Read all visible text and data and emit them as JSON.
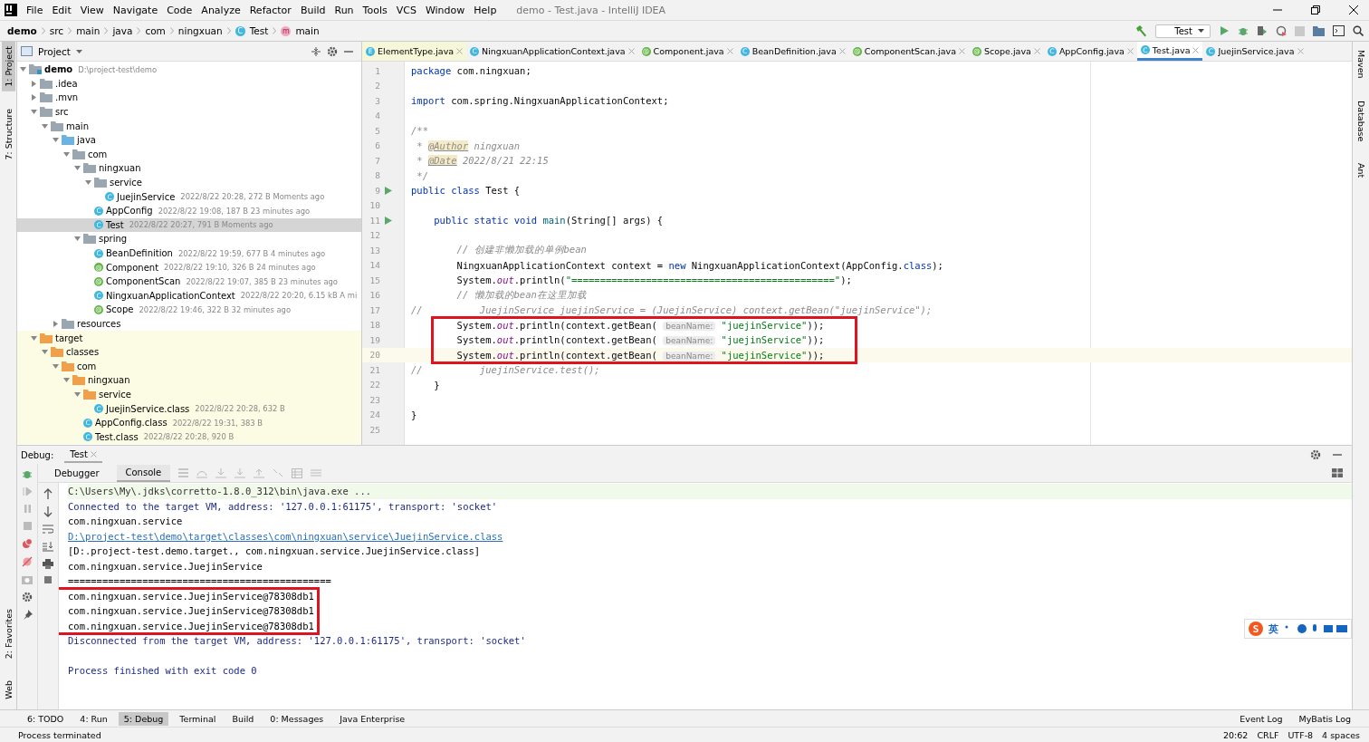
{
  "window": {
    "title": "demo - Test.java - IntelliJ IDEA"
  },
  "menu": [
    "File",
    "Edit",
    "View",
    "Navigate",
    "Code",
    "Analyze",
    "Refactor",
    "Build",
    "Run",
    "Tools",
    "VCS",
    "Window",
    "Help"
  ],
  "breadcrumbs": [
    {
      "label": "demo",
      "kind": "project"
    },
    {
      "label": "src",
      "kind": "dir"
    },
    {
      "label": "main",
      "kind": "dir"
    },
    {
      "label": "java",
      "kind": "dir"
    },
    {
      "label": "com",
      "kind": "dir"
    },
    {
      "label": "ningxuan",
      "kind": "dir"
    },
    {
      "label": "Test",
      "kind": "class",
      "icon": "C"
    },
    {
      "label": "main",
      "kind": "method",
      "icon": "m"
    }
  ],
  "run_config": "Test",
  "left_stripe": [
    {
      "label": "1: Project",
      "selected": true
    },
    {
      "label": "7: Structure",
      "selected": false
    }
  ],
  "left_stripe_bottom": [
    {
      "label": "2: Favorites",
      "selected": false
    },
    {
      "label": "Web",
      "selected": false
    }
  ],
  "right_stripe": [
    {
      "label": "Maven"
    },
    {
      "label": "Database"
    },
    {
      "label": "Ant"
    }
  ],
  "project_panel": {
    "title": "Project",
    "tree": [
      {
        "label": "demo",
        "kind": "module",
        "meta": "D:\\project-test\\demo",
        "expanded": true,
        "children": [
          {
            "label": ".idea",
            "kind": "folder",
            "expanded": false
          },
          {
            "label": ".mvn",
            "kind": "folder",
            "expanded": false
          },
          {
            "label": "src",
            "kind": "folder",
            "expanded": true,
            "children": [
              {
                "label": "main",
                "kind": "folder",
                "expanded": true,
                "children": [
                  {
                    "label": "java",
                    "kind": "source-root",
                    "expanded": true,
                    "children": [
                      {
                        "label": "com",
                        "kind": "package",
                        "expanded": true,
                        "children": [
                          {
                            "label": "ningxuan",
                            "kind": "package",
                            "expanded": true,
                            "children": [
                              {
                                "label": "service",
                                "kind": "package",
                                "expanded": true,
                                "children": [
                                  {
                                    "label": "JuejinService",
                                    "kind": "class",
                                    "icon": "C",
                                    "meta": "2022/8/22 20:28, 272 B Moments ago",
                                    "selected": false
                                  }
                                ]
                              },
                              {
                                "label": "AppConfig",
                                "kind": "class",
                                "icon": "C",
                                "meta": "2022/8/22 19:08, 187 B 23 minutes ago",
                                "selected": false
                              },
                              {
                                "label": "Test",
                                "kind": "runnable-class",
                                "icon": "C",
                                "meta": "2022/8/22 20:27, 791 B Moments ago",
                                "selected": true
                              }
                            ]
                          },
                          {
                            "label": "spring",
                            "kind": "package",
                            "expanded": true,
                            "children": [
                              {
                                "label": "BeanDefinition",
                                "kind": "class",
                                "icon": "C",
                                "meta": "2022/8/22 19:59, 677 B 4 minutes ago",
                                "selected": false
                              },
                              {
                                "label": "Component",
                                "kind": "annotation",
                                "icon": "@",
                                "meta": "2022/8/22 19:10, 326 B 24 minutes ago",
                                "selected": false
                              },
                              {
                                "label": "ComponentScan",
                                "kind": "annotation",
                                "icon": "@",
                                "meta": "2022/8/22 19:07, 385 B 23 minutes ago",
                                "selected": false
                              },
                              {
                                "label": "NingxuanApplicationContext",
                                "kind": "class",
                                "icon": "C",
                                "meta": "2022/8/22 20:20, 6.15 kB A mi",
                                "selected": false
                              },
                              {
                                "label": "Scope",
                                "kind": "annotation",
                                "icon": "@",
                                "meta": "2022/8/22 19:46, 322 B 32 minutes ago",
                                "selected": false
                              }
                            ]
                          }
                        ]
                      }
                    ]
                  },
                  {
                    "label": "resources",
                    "kind": "resources",
                    "expanded": false
                  }
                ]
              }
            ]
          },
          {
            "label": "target",
            "kind": "excluded-folder",
            "expanded": true,
            "children": [
              {
                "label": "classes",
                "kind": "excluded-folder",
                "expanded": true,
                "children": [
                  {
                    "label": "com",
                    "kind": "excluded-folder",
                    "expanded": true,
                    "children": [
                      {
                        "label": "ningxuan",
                        "kind": "excluded-folder",
                        "expanded": true,
                        "children": [
                          {
                            "label": "service",
                            "kind": "excluded-folder",
                            "expanded": true,
                            "children": [
                              {
                                "label": "JuejinService.class",
                                "kind": "class",
                                "icon": "C",
                                "meta": "2022/8/22 20:28, 632 B",
                                "selected": false
                              }
                            ]
                          },
                          {
                            "label": "AppConfig.class",
                            "kind": "class",
                            "icon": "C",
                            "meta": "2022/8/22 19:31, 383 B",
                            "selected": false
                          },
                          {
                            "label": "Test.class",
                            "kind": "runnable-class",
                            "icon": "C",
                            "meta": "2022/8/22 20:28, 920 B",
                            "selected": false
                          }
                        ]
                      }
                    ]
                  }
                ]
              }
            ]
          }
        ]
      }
    ]
  },
  "editor": {
    "tabs": [
      {
        "label": "ElementType.java",
        "kind": "enum",
        "icon": "E",
        "selected": false
      },
      {
        "label": "NingxuanApplicationContext.java",
        "kind": "class",
        "icon": "C",
        "selected": false
      },
      {
        "label": "Component.java",
        "kind": "annotation",
        "icon": "@",
        "selected": false
      },
      {
        "label": "BeanDefinition.java",
        "kind": "class",
        "icon": "C",
        "selected": false
      },
      {
        "label": "ComponentScan.java",
        "kind": "annotation",
        "icon": "@",
        "selected": false
      },
      {
        "label": "Scope.java",
        "kind": "annotation",
        "icon": "@",
        "selected": false
      },
      {
        "label": "AppConfig.java",
        "kind": "class",
        "icon": "C",
        "selected": false
      },
      {
        "label": "Test.java",
        "kind": "runnable-class",
        "icon": "C",
        "selected": true
      },
      {
        "label": "JuejinService.java",
        "kind": "class",
        "icon": "C",
        "selected": false
      }
    ],
    "lines": [
      {
        "num": "1",
        "run": false,
        "current": false,
        "segs": [
          {
            "kind": "keyword",
            "text": "package"
          },
          {
            "kind": "plain",
            "text": " com.ningxuan;"
          }
        ]
      },
      {
        "num": "2",
        "run": false,
        "current": false
      },
      {
        "num": "3",
        "run": false,
        "current": false,
        "segs": [
          {
            "kind": "keyword",
            "text": "import"
          },
          {
            "kind": "plain",
            "text": " com.spring.NingxuanApplicationContext;"
          }
        ]
      },
      {
        "num": "4",
        "run": false,
        "current": false
      },
      {
        "num": "5",
        "run": false,
        "current": false,
        "segs": [
          {
            "kind": "comment",
            "text": "/**"
          }
        ]
      },
      {
        "num": "6",
        "run": false,
        "current": false,
        "segs": [
          {
            "kind": "comment",
            "text": " * "
          },
          {
            "kind": "doctag",
            "text": "@Author"
          },
          {
            "kind": "comment",
            "text": " ningxuan"
          }
        ]
      },
      {
        "num": "7",
        "run": false,
        "current": false,
        "segs": [
          {
            "kind": "comment",
            "text": " * "
          },
          {
            "kind": "doctag",
            "text": "@Date"
          },
          {
            "kind": "comment",
            "text": " 2022/8/21 22:15"
          }
        ]
      },
      {
        "num": "8",
        "run": false,
        "current": false,
        "segs": [
          {
            "kind": "comment",
            "text": " */"
          }
        ]
      },
      {
        "num": "9",
        "run": true,
        "current": false,
        "segs": [
          {
            "kind": "keyword",
            "text": "public class"
          },
          {
            "kind": "plain",
            "text": " Test {"
          }
        ]
      },
      {
        "num": "10",
        "run": false,
        "current": false
      },
      {
        "num": "11",
        "run": true,
        "current": false,
        "segs": [
          {
            "kind": "keyword",
            "text": "    public static void"
          },
          {
            "kind": "method",
            "text": " main"
          },
          {
            "kind": "plain",
            "text": "(String[] args) {"
          }
        ]
      },
      {
        "num": "12",
        "run": false,
        "current": false
      },
      {
        "num": "13",
        "run": false,
        "current": false,
        "segs": [
          {
            "kind": "comment",
            "text": "        // 创建非懒加载的单例bean"
          }
        ]
      },
      {
        "num": "14",
        "run": false,
        "current": false,
        "segs": [
          {
            "kind": "plain",
            "text": "        NingxuanApplicationContext context = "
          },
          {
            "kind": "keyword",
            "text": "new"
          },
          {
            "kind": "plain",
            "text": " NingxuanApplicationContext(AppConfig."
          },
          {
            "kind": "keyword",
            "text": "class"
          },
          {
            "kind": "plain",
            "text": ");"
          }
        ]
      },
      {
        "num": "15",
        "run": false,
        "current": false,
        "segs": [
          {
            "kind": "plain",
            "text": "        System."
          },
          {
            "kind": "field",
            "text": "out"
          },
          {
            "kind": "plain",
            "text": ".println("
          },
          {
            "kind": "string",
            "text": "\"==============================================\""
          },
          {
            "kind": "plain",
            "text": ");"
          }
        ]
      },
      {
        "num": "16",
        "run": false,
        "current": false,
        "segs": [
          {
            "kind": "comment",
            "text": "        // 懒加载的bean在这里加载"
          }
        ]
      },
      {
        "num": "17",
        "run": false,
        "current": false,
        "segs": [
          {
            "kind": "comment",
            "text": "//          JuejinService juejinService = (JuejinService) context.getBean(\"juejinService\");"
          }
        ]
      },
      {
        "num": "18",
        "run": false,
        "current": false,
        "boxed": true,
        "segs": [
          {
            "kind": "plain",
            "text": "        System."
          },
          {
            "kind": "field",
            "text": "out"
          },
          {
            "kind": "plain",
            "text": ".println(context.getBean( "
          },
          {
            "kind": "hint",
            "text": "beanName:"
          },
          {
            "kind": "string",
            "text": " \"juejinService\""
          },
          {
            "kind": "plain",
            "text": "));"
          }
        ]
      },
      {
        "num": "19",
        "run": false,
        "current": false,
        "boxed": true,
        "segs": [
          {
            "kind": "plain",
            "text": "        System."
          },
          {
            "kind": "field",
            "text": "out"
          },
          {
            "kind": "plain",
            "text": ".println(context.getBean( "
          },
          {
            "kind": "hint",
            "text": "beanName:"
          },
          {
            "kind": "string",
            "text": " \"juejinService\""
          },
          {
            "kind": "plain",
            "text": "));"
          }
        ]
      },
      {
        "num": "20",
        "run": false,
        "current": true,
        "boxed": true,
        "segs": [
          {
            "kind": "plain",
            "text": "        System."
          },
          {
            "kind": "field",
            "text": "out"
          },
          {
            "kind": "plain",
            "text": ".println(context.getBean( "
          },
          {
            "kind": "hint",
            "text": "beanName:"
          },
          {
            "kind": "string",
            "text": " \"juejinService\""
          },
          {
            "kind": "plain",
            "text": "));"
          }
        ]
      },
      {
        "num": "21",
        "run": false,
        "current": false,
        "segs": [
          {
            "kind": "comment",
            "text": "//          juejinService.test();"
          }
        ]
      },
      {
        "num": "22",
        "run": false,
        "current": false,
        "segs": [
          {
            "kind": "plain",
            "text": "    }"
          }
        ]
      },
      {
        "num": "23",
        "run": false,
        "current": false
      },
      {
        "num": "24",
        "run": false,
        "current": false,
        "segs": [
          {
            "kind": "plain",
            "text": "}"
          }
        ]
      },
      {
        "num": "25",
        "run": false,
        "current": false
      }
    ]
  },
  "debug": {
    "label": "Debug:",
    "tab": "Test",
    "subtabs": [
      {
        "label": "Debugger",
        "selected": false
      },
      {
        "label": "Console",
        "selected": true
      }
    ],
    "console": [
      {
        "kind": "command",
        "text": "C:\\Users\\My\\.jdks\\corretto-1.8.0_312\\bin\\java.exe ..."
      },
      {
        "kind": "system",
        "text": "Connected to the target VM, address: '127.0.0.1:61175', transport: 'socket'"
      },
      {
        "kind": "output",
        "text": "com.ningxuan.service"
      },
      {
        "kind": "link",
        "text": "D:\\project-test\\demo\\target\\classes\\com\\ningxuan\\service\\JuejinService.class"
      },
      {
        "kind": "output",
        "text": "[D:.project-test.demo.target., com.ningxuan.service.JuejinService.class]"
      },
      {
        "kind": "output",
        "text": "com.ningxuan.service.JuejinService"
      },
      {
        "kind": "output",
        "text": "=============================================="
      },
      {
        "kind": "output",
        "boxed": true,
        "text": "com.ningxuan.service.JuejinService@78308db1"
      },
      {
        "kind": "output",
        "boxed": true,
        "text": "com.ningxuan.service.JuejinService@78308db1"
      },
      {
        "kind": "output",
        "boxed": true,
        "text": "com.ningxuan.service.JuejinService@78308db1"
      },
      {
        "kind": "system",
        "text": "Disconnected from the target VM, address: '127.0.0.1:61175', transport: 'socket'"
      },
      {
        "kind": "blank"
      },
      {
        "kind": "system",
        "text": "Process finished with exit code 0"
      }
    ]
  },
  "ime_bar": {
    "logo": "S",
    "label": "英"
  },
  "tool_windows": [
    {
      "label": "6: TODO",
      "selected": false
    },
    {
      "label": "4: Run",
      "selected": false
    },
    {
      "label": "5: Debug",
      "selected": true
    },
    {
      "label": "Terminal",
      "selected": false
    },
    {
      "label": "Build",
      "selected": false
    },
    {
      "label": "0: Messages",
      "selected": false
    },
    {
      "label": "Java Enterprise",
      "selected": false
    }
  ],
  "tool_windows_right": [
    "Event Log",
    "MyBatis Log"
  ],
  "status": {
    "message": "Process terminated",
    "items": [
      "20:62",
      "CRLF",
      "UTF-8",
      "4 spaces"
    ]
  }
}
